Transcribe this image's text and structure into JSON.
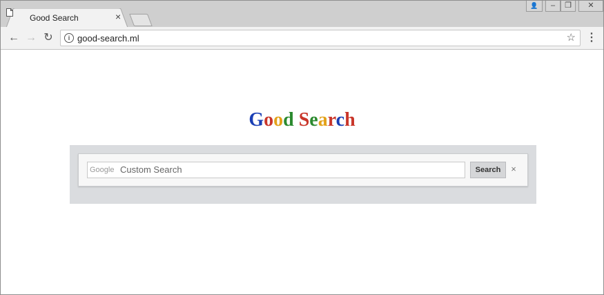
{
  "browser": {
    "tab_title": "Good Search",
    "tab_close": "×",
    "url": "good-search.ml",
    "back": "←",
    "forward": "→",
    "reload": "↻",
    "star": "☆",
    "menu": "⋮",
    "info": "i",
    "window_controls": {
      "user": "👤",
      "minimize": "‒",
      "restore": "❐",
      "close": "✕"
    }
  },
  "page": {
    "logo_letters": [
      {
        "char": "G",
        "color": "#1a3fb5"
      },
      {
        "char": "o",
        "color": "#c9362a"
      },
      {
        "char": "o",
        "color": "#e3a21a"
      },
      {
        "char": "d",
        "color": "#2b8a2f"
      },
      {
        "char": " ",
        "color": "#000000"
      },
      {
        "char": "S",
        "color": "#c9362a"
      },
      {
        "char": "e",
        "color": "#2b8a2f"
      },
      {
        "char": "a",
        "color": "#e3a21a"
      },
      {
        "char": "r",
        "color": "#c9362a"
      },
      {
        "char": "c",
        "color": "#1a3fb5"
      },
      {
        "char": "h",
        "color": "#c9362a"
      }
    ],
    "search": {
      "google_label": "Google",
      "placeholder": "Custom Search",
      "button_label": "Search",
      "clear_label": "×"
    }
  }
}
